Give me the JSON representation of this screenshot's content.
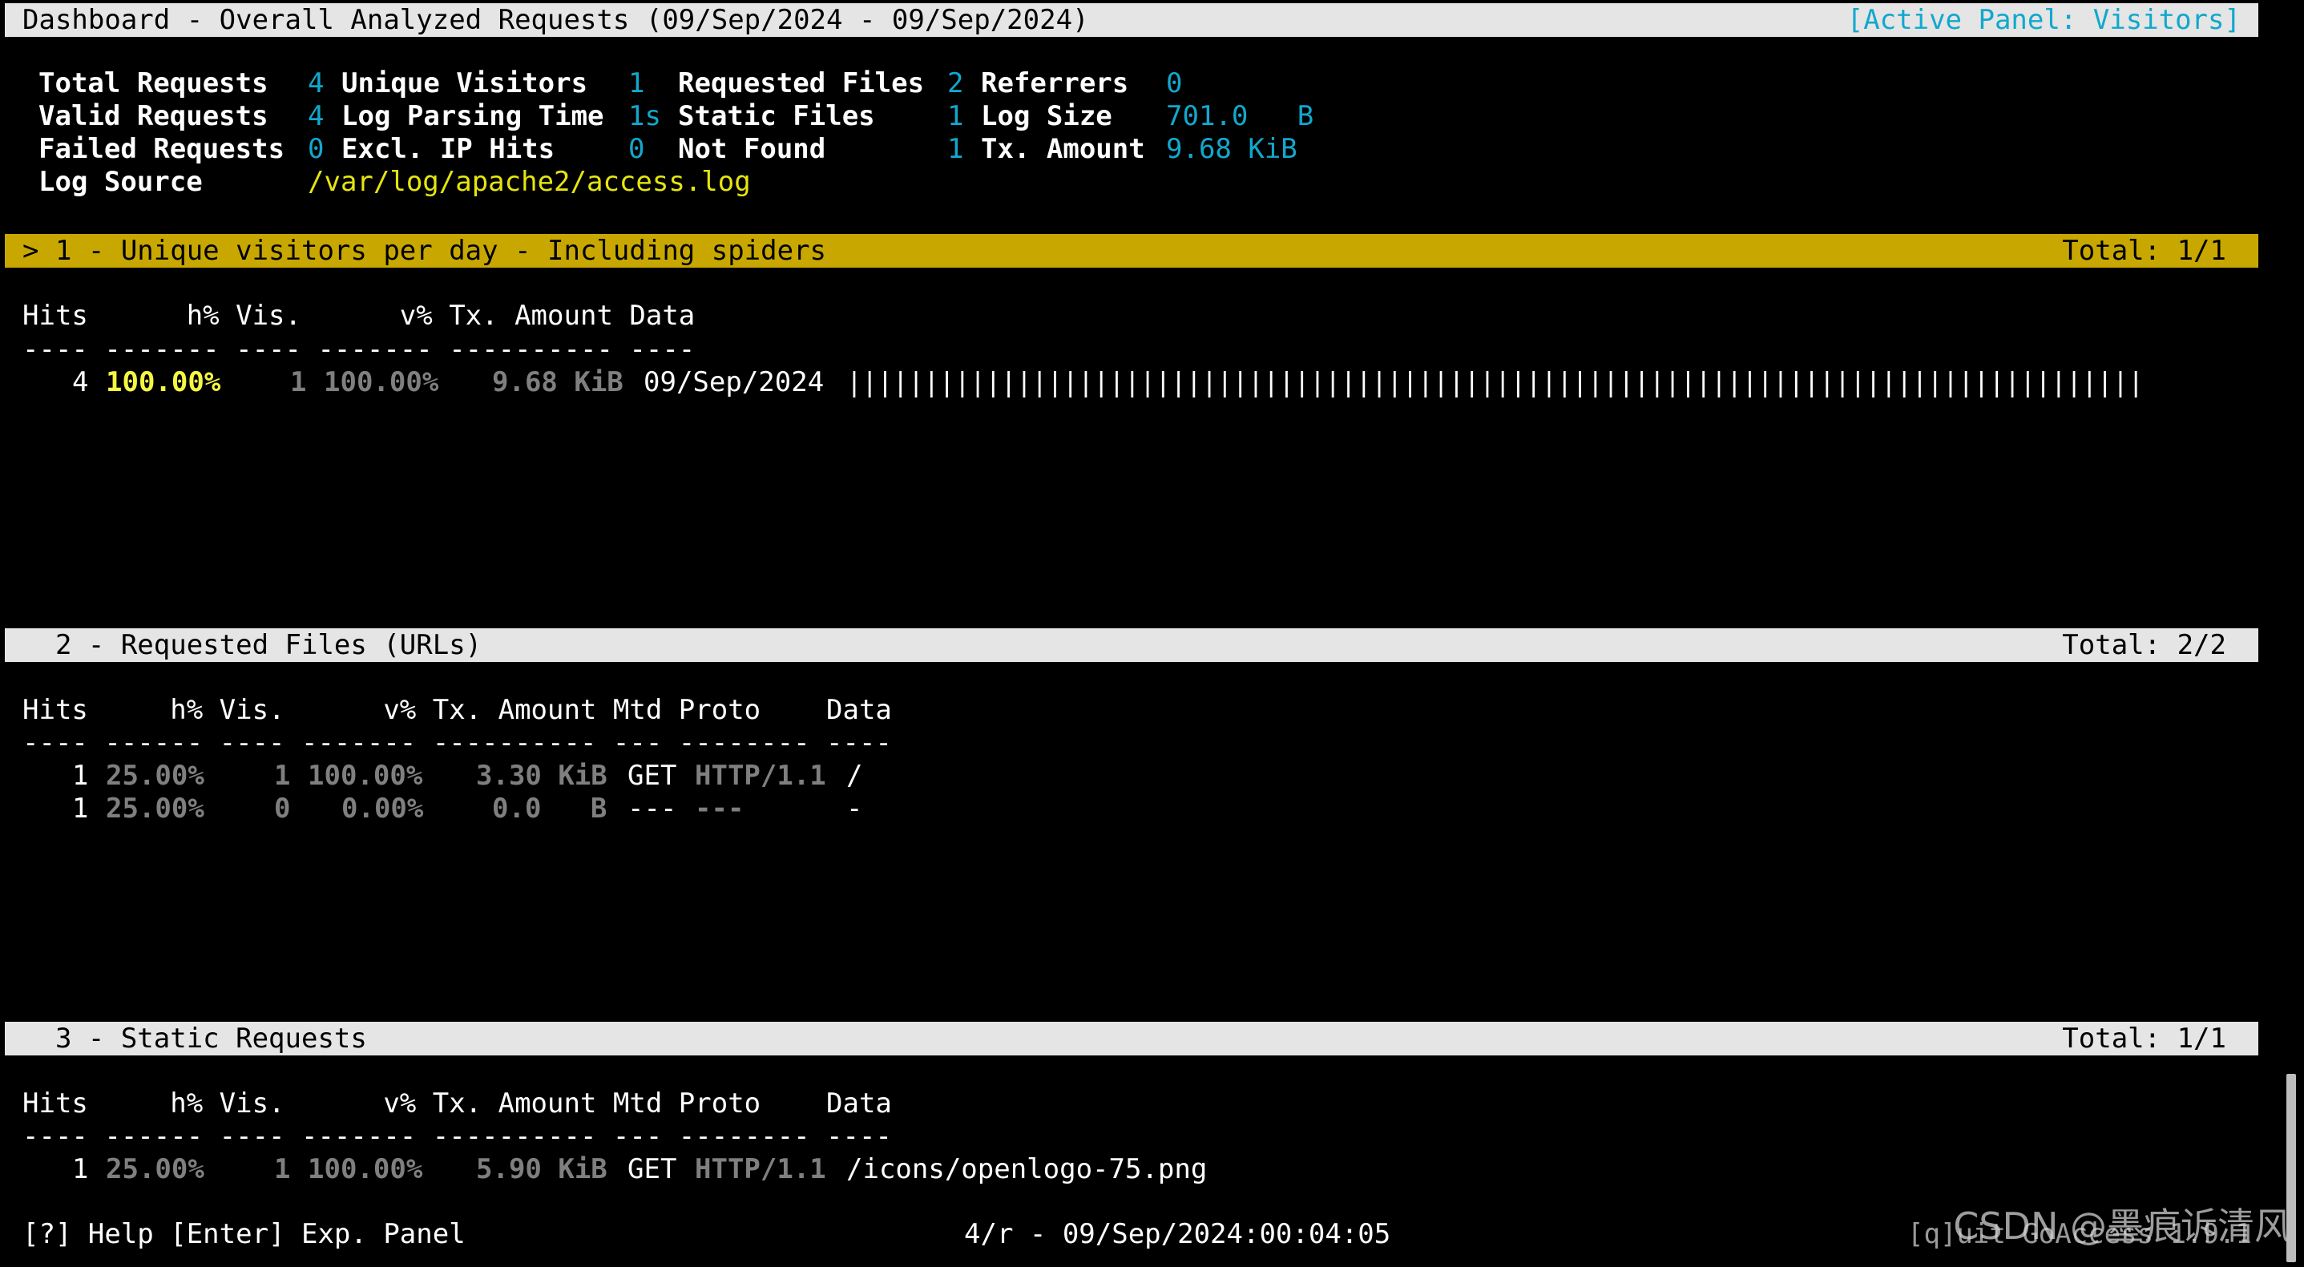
{
  "header": {
    "title": "Dashboard - Overall Analyzed Requests (09/Sep/2024 - 09/Sep/2024)",
    "active_panel": "[Active Panel: Visitors]"
  },
  "overview": {
    "total_requests_label": "Total Requests",
    "total_requests": "4",
    "unique_visitors_label": "Unique Visitors",
    "unique_visitors": "1",
    "requested_files_label": "Requested Files",
    "requested_files": "2",
    "referrers_label": "Referrers",
    "referrers": "0",
    "valid_requests_label": "Valid Requests",
    "valid_requests": "4",
    "log_parsing_time_label": "Log Parsing Time",
    "log_parsing_time": "1s",
    "static_files_label": "Static Files",
    "static_files": "1",
    "log_size_label": "Log Size",
    "log_size": "701.0   B",
    "failed_requests_label": "Failed Requests",
    "failed_requests": "0",
    "excl_ip_hits_label": "Excl. IP Hits",
    "excl_ip_hits": "0",
    "not_found_label": "Not Found",
    "not_found": "1",
    "tx_amount_label": "Tx. Amount",
    "tx_amount": "9.68 KiB",
    "log_source_label": "Log Source",
    "log_source": "/var/log/apache2/access.log"
  },
  "panels": [
    {
      "title": "> 1 - Unique visitors per day - Including spiders",
      "total": "Total: 1/1",
      "header": "Hits      h% Vis.      v% Tx. Amount Data",
      "divider": "---- ------- ---- ------- ---------- ----",
      "rows": [
        {
          "hits": "4",
          "hits_pct": "100.00%",
          "visitors": "1",
          "visitors_pct": "100.00%",
          "tx": "9.68 KiB",
          "data": "09/Sep/2024",
          "bar": "||||||||||||||||||||||||||||||||||||||||||||||||||||||||||||||||||||||||||||||||||||"
        }
      ]
    },
    {
      "title": "  2 - Requested Files (URLs)",
      "total": "Total: 2/2",
      "header": "Hits     h% Vis.      v% Tx. Amount Mtd Proto    Data",
      "divider": "---- ------ ---- ------- ---------- --- -------- ----",
      "rows": [
        {
          "hits": "1",
          "hits_pct": "25.00%",
          "visitors": "1",
          "visitors_pct": "100.00%",
          "tx": "3.30 KiB",
          "method": "GET",
          "proto": "HTTP/1.1",
          "data": "/"
        },
        {
          "hits": "1",
          "hits_pct": "25.00%",
          "visitors": "0",
          "visitors_pct": "0.00%",
          "tx": "0.0   B",
          "method": "---",
          "proto": "---",
          "data": "-"
        }
      ]
    },
    {
      "title": "  3 - Static Requests",
      "total": "Total: 1/1",
      "header": "Hits     h% Vis.      v% Tx. Amount Mtd Proto    Data",
      "divider": "---- ------ ---- ------- ---------- --- -------- ----",
      "rows": [
        {
          "hits": "1",
          "hits_pct": "25.00%",
          "visitors": "1",
          "visitors_pct": "100.00%",
          "tx": "5.90 KiB",
          "method": "GET",
          "proto": "HTTP/1.1",
          "data": "/icons/openlogo-75.png"
        }
      ]
    }
  ],
  "footer": {
    "help": "[?] Help [Enter] Exp. Panel",
    "status": "4/r - 09/Sep/2024:00:04:05",
    "quit": "[q]uit GoAccess 1.9.1"
  },
  "watermark": "CSDN @墨痕诉清风",
  "colors": {
    "background": "#000000",
    "bar_gray": "#e5e5e5",
    "active_panel_bar": "#c8a800",
    "cyan": "#11a8cd",
    "yellow": "#e5e510",
    "gray": "#7f7f7f"
  }
}
